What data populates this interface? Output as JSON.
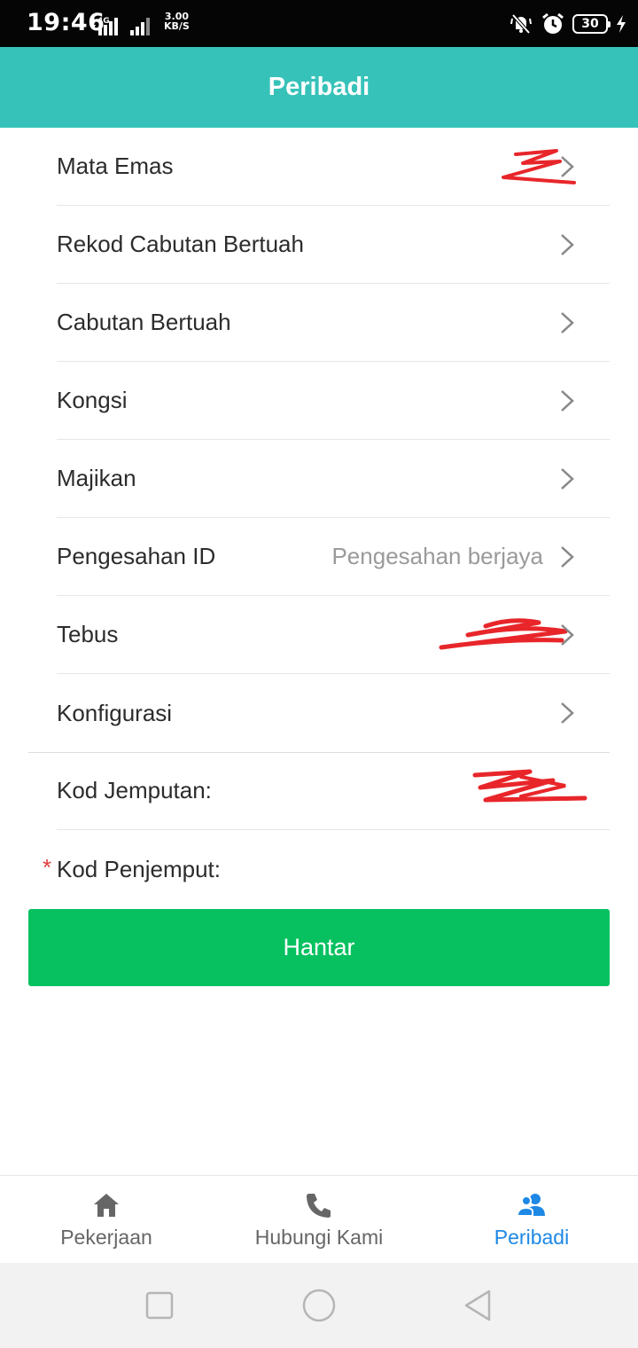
{
  "status_bar": {
    "time": "19:46",
    "network": "4G",
    "speed_value": "3.00",
    "speed_unit": "KB/S",
    "battery": "30"
  },
  "header": {
    "title": "Peribadi"
  },
  "menu": {
    "items": [
      {
        "label": "Mata Emas",
        "value": "",
        "redacted": true
      },
      {
        "label": "Rekod Cabutan Bertuah",
        "value": ""
      },
      {
        "label": "Cabutan Bertuah",
        "value": ""
      },
      {
        "label": "Kongsi",
        "value": ""
      },
      {
        "label": "Majikan",
        "value": ""
      },
      {
        "label": "Pengesahan ID",
        "value": "Pengesahan berjaya"
      },
      {
        "label": "Tebus",
        "value": "",
        "redacted": true
      },
      {
        "label": "Konfigurasi",
        "value": ""
      }
    ]
  },
  "invite": {
    "code_label": "Kod Jemputan:",
    "code_redacted": true,
    "referrer_label": "Kod Penjemput:",
    "required_mark": "*"
  },
  "submit_label": "Hantar",
  "tabbar": {
    "tabs": [
      {
        "label": "Pekerjaan",
        "icon": "home-icon",
        "active": false
      },
      {
        "label": "Hubungi Kami",
        "icon": "phone-icon",
        "active": false
      },
      {
        "label": "Peribadi",
        "icon": "users-icon",
        "active": true
      }
    ]
  },
  "colors": {
    "header": "#36c2b9",
    "submit": "#07c160",
    "active_tab": "#1e88e5",
    "required": "#e43b3b",
    "redaction": "#e8262a"
  }
}
